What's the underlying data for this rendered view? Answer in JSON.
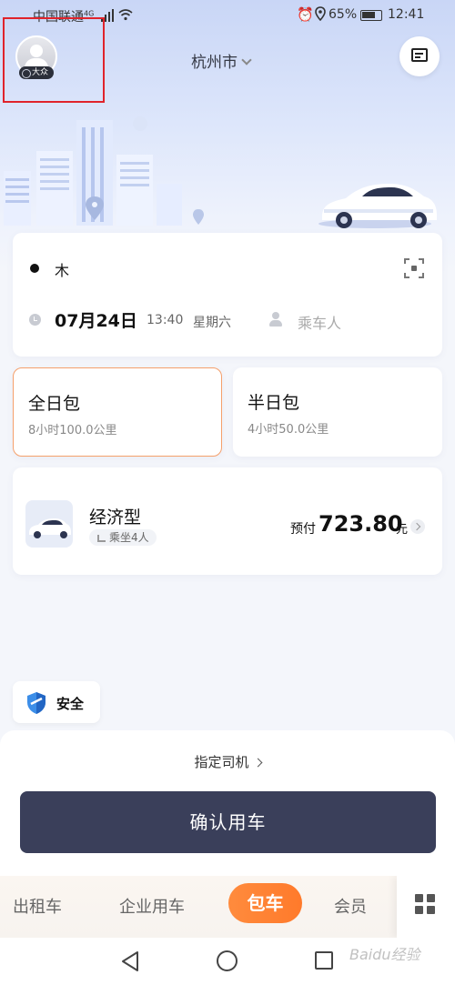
{
  "status_bar": {
    "carrier": "中国联通",
    "network": "4G",
    "battery": "65%",
    "time": "12:41"
  },
  "header": {
    "avatar_badge": "大众",
    "city": "杭州市"
  },
  "route": {
    "start_text": "木",
    "date": "07月24日",
    "time": "13:40",
    "weekday": "星期六",
    "passenger_placeholder": "乘车人"
  },
  "packages": [
    {
      "title": "全日包",
      "subtitle": "8小时100.0公里",
      "selected": true
    },
    {
      "title": "半日包",
      "subtitle": "4小时50.0公里",
      "selected": false
    }
  ],
  "car": {
    "name": "经济型",
    "seats": "乘坐4人",
    "prepay_label": "预付",
    "price": "723.80",
    "unit": "元"
  },
  "safety": {
    "label": "安全"
  },
  "sheet": {
    "driver_link": "指定司机",
    "confirm": "确认用车"
  },
  "tabs": [
    {
      "label": "出租车"
    },
    {
      "label": "企业用车"
    },
    {
      "label": "包车",
      "active": true
    },
    {
      "label": "会员"
    }
  ],
  "watermark": "Baidu经验",
  "colors": {
    "accent_orange": "#ff7a2b",
    "confirm_bg": "#3a3f5a",
    "highlight_border": "#e0232b"
  }
}
